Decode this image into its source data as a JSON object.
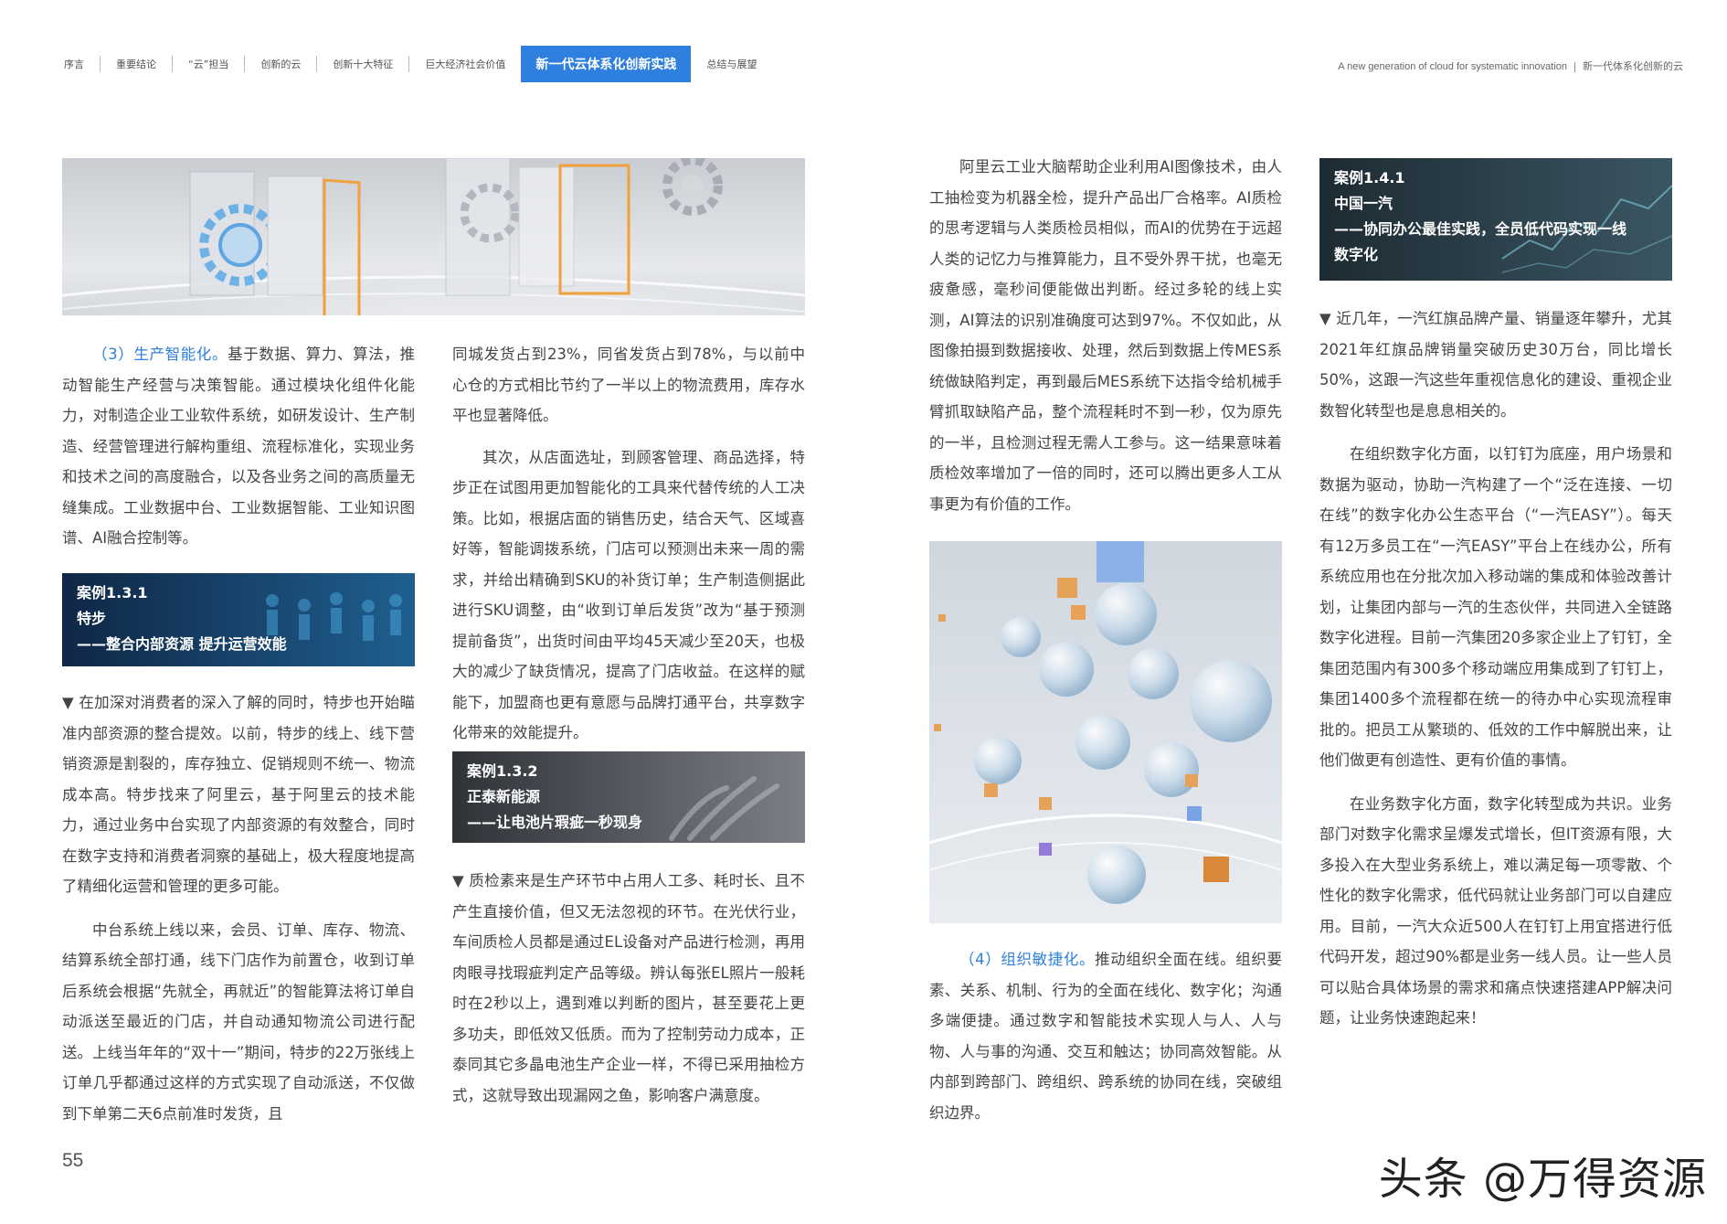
{
  "nav": {
    "items": [
      "序言",
      "重要结论",
      "“云”担当",
      "创新的云",
      "创新十大特征",
      "巨大经济社会价值",
      "新一代云体系化创新实践",
      "总结与展望"
    ],
    "active_index": 6
  },
  "tagline": {
    "en": "A new generation of cloud for systematic innovation",
    "cn": "新一代体系化创新的云"
  },
  "col1": {
    "p1_head": "（3）生产智能化。",
    "p1_body": "基于数据、算力、算法，推动智能生产经营与决策智能。通过模块化组件化能力，对制造企业工业软件系统，如研发设计、生产制造、经营管理进行解构重组、流程标准化，实现业务和技术之间的高度融合，以及各业务之间的高质量无缝集成。工业数据中台、工业数据智能、工业知识图谱、AI融合控制等。",
    "case": {
      "line1": "案例1.3.1",
      "line2": "特步",
      "line3": "——整合内部资源 提升运营效能"
    },
    "p2": "▼ 在加深对消费者的深入了解的同时，特步也开始瞄准内部资源的整合提效。以前，特步的线上、线下营销资源是割裂的，库存独立、促销规则不统一、物流成本高。特步找来了阿里云，基于阿里云的技术能力，通过业务中台实现了内部资源的有效整合，同时在数字支持和消费者洞察的基础上，极大程度地提高了精细化运营和管理的更多可能。",
    "p3": "中台系统上线以来，会员、订单、库存、物流、结算系统全部打通，线下门店作为前置仓，收到订单后系统会根据“先就全，再就近”的智能算法将订单自动派送至最近的门店，并自动通知物流公司进行配送。上线当年年的“双十一”期间，特步的22万张线上订单几乎都通过这样的方式实现了自动派送，不仅做到下单第二天6点前准时发货，且"
  },
  "col2": {
    "p1": "同城发货占到23%，同省发货占到78%，与以前中心仓的方式相比节约了一半以上的物流费用，库存水平也显著降低。",
    "p2": "其次，从店面选址，到顾客管理、商品选择，特步正在试图用更加智能化的工具来代替传统的人工决策。比如，根据店面的销售历史，结合天气、区域喜好等，智能调拨系统，门店可以预测出未来一周的需求，并给出精确到SKU的补货订单；生产制造侧据此进行SKU调整，由“收到订单后发货”改为“基于预测提前备货”，出货时间由平均45天减少至20天，也极大的减少了缺货情况，提高了门店收益。在这样的赋能下，加盟商也更有意愿与品牌打通平台，共享数字化带来的效能提升。",
    "case": {
      "line1": "案例1.3.2",
      "line2": "正泰新能源",
      "line3": "——让电池片瑕疵一秒现身"
    },
    "p3": "▼ 质检素来是生产环节中占用人工多、耗时长、且不产生直接价值，但又无法忽视的环节。在光伏行业，车间质检人员都是通过EL设备对产品进行检测，再用肉眼寻找瑕疵判定产品等级。辨认每张EL照片一般耗时在2秒以上，遇到难以判断的图片，甚至要花上更多功夫，即低效又低质。而为了控制劳动力成本，正泰同其它多晶电池生产企业一样，不得已采用抽检方式，这就导致出现漏网之鱼，影响客户满意度。"
  },
  "col3": {
    "p1": "阿里云工业大脑帮助企业利用AI图像技术，由人工抽检变为机器全检，提升产品出厂合格率。AI质检的思考逻辑与人类质检员相似，而AI的优势在于远超人类的记忆力与推算能力，且不受外界干扰，也毫无疲惫感，毫秒间便能做出判断。经过多轮的线上实测，AI算法的识别准确度可达到97%。不仅如此，从图像拍摄到数据接收、处理，然后到数据上传MES系统做缺陷判定，再到最后MES系统下达指令给机械手臂抓取缺陷产品，整个流程耗时不到一秒，仅为原先的一半，且检测过程无需人工参与。这一结果意味着质检效率增加了一倍的同时，还可以腾出更多人工从事更为有价值的工作。",
    "p2_head": "（4）组织敏捷化。",
    "p2_body": "推动组织全面在线。组织要素、关系、机制、行为的全面在线化、数字化；沟通多端便捷。通过数字和智能技术实现人与人、人与物、人与事的沟通、交互和触达；协同高效智能。从内部到跨部门、跨组织、跨系统的协同在线，突破组织边界。"
  },
  "col4": {
    "case": {
      "line1": "案例1.4.1",
      "line2": "中国一汽",
      "line3": "——协同办公最佳实践，全员低代码实现一线",
      "line4": "数字化"
    },
    "p1": "▼ 近几年，一汽红旗品牌产量、销量逐年攀升，尤其2021年红旗品牌销量突破历史30万台，同比增长50%，这跟一汽这些年重视信息化的建设、重视企业数智化转型也是息息相关的。",
    "p2": "在组织数字化方面，以钉钉为底座，用户场景和数据为驱动，协助一汽构建了一个“泛在连接、一切在线”的数字化办公生态平台（“一汽EASY”）。每天有12万多员工在“一汽EASY”平台上在线办公，所有系统应用也在分批次加入移动端的集成和体验改善计划，让集团内部与一汽的生态伙伴，共同进入全链路数字化进程。目前一汽集团20多家企业上了钉钉，全集团范围内有300多个移动端应用集成到了钉钉上，集团1400多个流程都在统一的待办中心实现流程审批的。把员工从繁琐的、低效的工作中解脱出来，让他们做更有创造性、更有价值的事情。",
    "p3": "在业务数字化方面，数字化转型成为共识。业务部门对数字化需求呈爆发式增长，但IT资源有限，大多投入在大型业务系统上，难以满足每一项零散、个性化的数字化需求，低代码就让业务部门可以自建应用。目前，一汽大众近500人在钉钉上用宜搭进行低代码开发，超过90%都是业务一线人员。让一些人员可以贴合具体场景的需求和痛点快速搭建APP解决问题，让业务快速跑起来！"
  },
  "footer": {
    "page_number": "55",
    "watermark": "头条 @万得资源"
  },
  "colors": {
    "accent": "#2e7fde",
    "text": "#444444"
  }
}
